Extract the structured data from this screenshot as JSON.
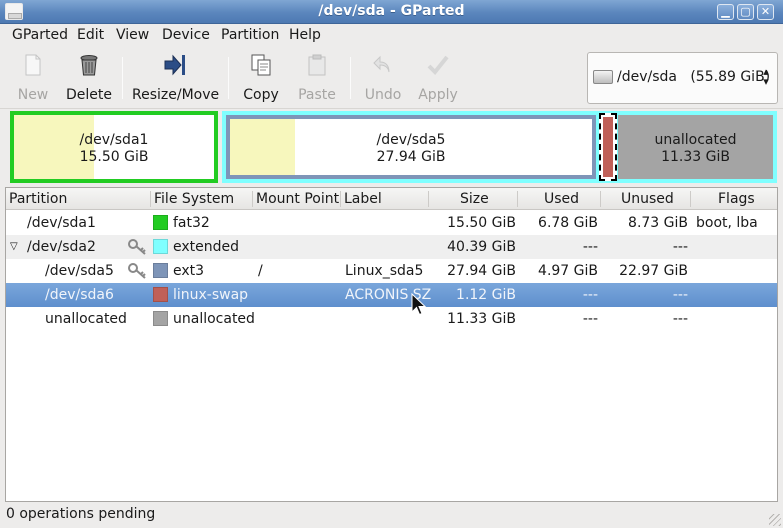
{
  "window": {
    "title": "/dev/sda - GParted",
    "controls": {
      "minimize": "▁",
      "maximize": "▢",
      "close": "✕"
    }
  },
  "menu": [
    "GParted",
    "Edit",
    "View",
    "Device",
    "Partition",
    "Help"
  ],
  "toolbar": {
    "buttons": [
      {
        "label": "New",
        "icon": "new-icon",
        "enabled": false
      },
      {
        "label": "Delete",
        "icon": "trash-icon",
        "enabled": true
      },
      {
        "label": "Resize/Move",
        "icon": "resize-move-icon",
        "enabled": true
      },
      {
        "label": "Copy",
        "icon": "copy-icon",
        "enabled": true
      },
      {
        "label": "Paste",
        "icon": "paste-icon",
        "enabled": false
      },
      {
        "label": "Undo",
        "icon": "undo-icon",
        "enabled": false
      },
      {
        "label": "Apply",
        "icon": "apply-icon",
        "enabled": false
      }
    ]
  },
  "device": {
    "name": "/dev/sda",
    "size": "(55.89 GiB)"
  },
  "diskmap": {
    "partitions": [
      {
        "name": "/dev/sda1",
        "size": "15.50 GiB",
        "border_color": "#22cc22",
        "selected": false,
        "used_fraction": 0.44
      },
      {
        "name": "/dev/sda5",
        "size": "27.94 GiB",
        "border_color": "#7ea2c9",
        "selected": false,
        "used_fraction": 0.18
      },
      {
        "name": "",
        "size": "",
        "border_color": "#cc6655",
        "selected": true,
        "used_fraction": 0
      },
      {
        "name": "unallocated",
        "size": "11.33 GiB",
        "border_color": "#a4a4a4",
        "selected": false,
        "used_fraction": 1
      }
    ],
    "extended_color": "#7fffff"
  },
  "table": {
    "columns": [
      "Partition",
      "File System",
      "Mount Point",
      "Label",
      "Size",
      "Used",
      "Unused",
      "Flags"
    ],
    "rows": [
      {
        "partition": "/dev/sda1",
        "fs": "fat32",
        "fs_color": "#22cc22",
        "mount": "",
        "label": "",
        "size": "15.50 GiB",
        "used": "6.78 GiB",
        "unused": "8.73 GiB",
        "flags": "boot, lba",
        "locked": false
      },
      {
        "partition": "/dev/sda2",
        "fs": "extended",
        "fs_color": "#7fffff",
        "mount": "",
        "label": "",
        "size": "40.39 GiB",
        "used": "---",
        "unused": "---",
        "flags": "",
        "locked": true
      },
      {
        "partition": "/dev/sda5",
        "fs": "ext3",
        "fs_color": "#7e95b8",
        "mount": "/",
        "label": "Linux_sda5",
        "size": "27.94 GiB",
        "used": "4.97 GiB",
        "unused": "22.97 GiB",
        "flags": "",
        "locked": true
      },
      {
        "partition": "/dev/sda6",
        "fs": "linux-swap",
        "fs_color": "#c06058",
        "mount": "",
        "label": "ACRONIS SZ",
        "size": "1.12 GiB",
        "used": "---",
        "unused": "---",
        "flags": "",
        "locked": false
      },
      {
        "partition": "unallocated",
        "fs": "unallocated",
        "fs_color": "#a4a4a4",
        "mount": "",
        "label": "",
        "size": "11.33 GiB",
        "used": "---",
        "unused": "---",
        "flags": "",
        "locked": false
      }
    ]
  },
  "status": {
    "text": "0 operations pending"
  }
}
